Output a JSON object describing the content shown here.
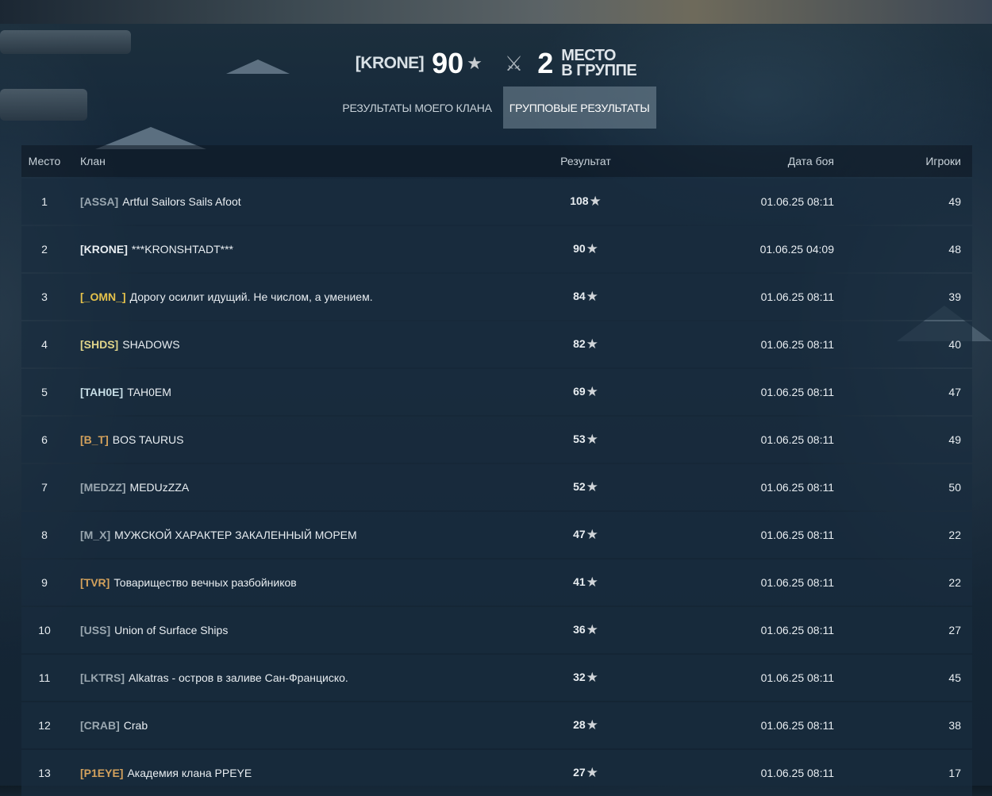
{
  "header": {
    "clan_tag": "[KRONE]",
    "score": "90",
    "rank": "2",
    "rank_label_line1": "МЕСТО",
    "rank_label_line2": "В ГРУППЕ"
  },
  "tabs": [
    {
      "label": "РЕЗУЛЬТАТЫ МОЕГО КЛАНА",
      "active": false
    },
    {
      "label": "ГРУППОВЫЕ РЕЗУЛЬТАТЫ",
      "active": true
    }
  ],
  "table": {
    "columns": {
      "place": "Место",
      "clan": "Клан",
      "result": "Результат",
      "date": "Дата боя",
      "players": "Игроки"
    },
    "rows": [
      {
        "place": "1",
        "tag": "[ASSA]",
        "tag_color": "#9aa7b0",
        "name": "Artful Sailors Sails Afoot",
        "result": "108",
        "date": "01.06.25 08:11",
        "players": "49"
      },
      {
        "place": "2",
        "tag": "[KRONE]",
        "tag_color": "#e8edf1",
        "name": "***KRONSHTADT***",
        "result": "90",
        "date": "01.06.25 04:09",
        "players": "48"
      },
      {
        "place": "3",
        "tag": "[_OMN_]",
        "tag_color": "#e5c24b",
        "name": "Дорогу осилит идущий. Не числом, а умением.",
        "result": "84",
        "date": "01.06.25 08:11",
        "players": "39"
      },
      {
        "place": "4",
        "tag": "[SHDS]",
        "tag_color": "#e0d48a",
        "name": "SHADOWS",
        "result": "82",
        "date": "01.06.25 08:11",
        "players": "40"
      },
      {
        "place": "5",
        "tag": "[TAH0E]",
        "tag_color": "#c6dde6",
        "name": "TAH0EM",
        "result": "69",
        "date": "01.06.25 08:11",
        "players": "47"
      },
      {
        "place": "6",
        "tag": "[B_T]",
        "tag_color": "#d3a15c",
        "name": "BOS TAURUS",
        "result": "53",
        "date": "01.06.25 08:11",
        "players": "49"
      },
      {
        "place": "7",
        "tag": "[MEDZZ]",
        "tag_color": "#9aa7b0",
        "name": "MEDUzZZA",
        "result": "52",
        "date": "01.06.25 08:11",
        "players": "50"
      },
      {
        "place": "8",
        "tag": "[M_X]",
        "tag_color": "#9aa7b0",
        "name": "МУЖСКОЙ ХАРАКТЕР ЗАКАЛЕННЫЙ МОРЕМ",
        "result": "47",
        "date": "01.06.25 08:11",
        "players": "22"
      },
      {
        "place": "9",
        "tag": "[TVR]",
        "tag_color": "#d3a15c",
        "name": "Товарищество вечных разбойников",
        "result": "41",
        "date": "01.06.25 08:11",
        "players": "22"
      },
      {
        "place": "10",
        "tag": "[USS]",
        "tag_color": "#9aa7b0",
        "name": "Union of Surface Ships",
        "result": "36",
        "date": "01.06.25 08:11",
        "players": "27"
      },
      {
        "place": "11",
        "tag": "[LKTRS]",
        "tag_color": "#9aa7b0",
        "name": "Alkatras - остров в заливе Сан-Франциско.",
        "result": "32",
        "date": "01.06.25 08:11",
        "players": "45"
      },
      {
        "place": "12",
        "tag": "[CRAB]",
        "tag_color": "#9aa7b0",
        "name": "Crab",
        "result": "28",
        "date": "01.06.25 08:11",
        "players": "38"
      },
      {
        "place": "13",
        "tag": "[P1EYE]",
        "tag_color": "#d3a15c",
        "name": "Академия клана PPEYE",
        "result": "27",
        "date": "01.06.25 08:11",
        "players": "17"
      }
    ]
  }
}
